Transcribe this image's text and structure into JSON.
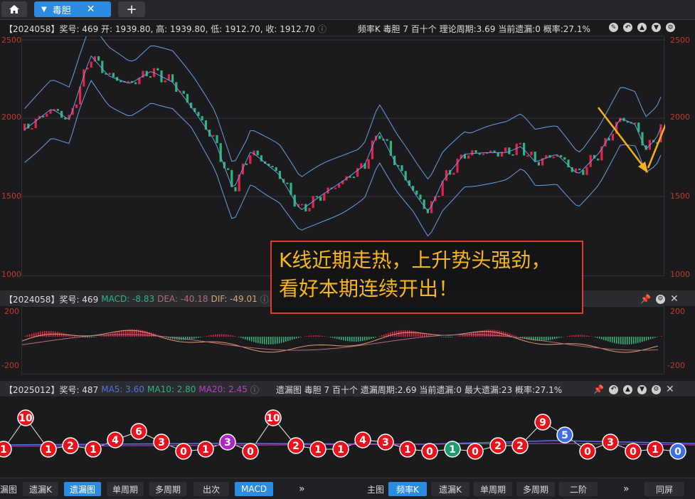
{
  "tabs": {
    "home_icon": "home-icon",
    "active_label": "毒胆",
    "add_label": "+"
  },
  "kline": {
    "header_left": "【2024058】奖号: 469  开: 1939.80, 高: 1939.80, 低: 1912.70, 收: 1912.70",
    "header_right": "频率K   毒胆   7   百十个   理论周期:3.69   当前遗漏:0   概率:27.1%",
    "y_ticks": [
      "2500",
      "2000",
      "1500",
      "1000"
    ]
  },
  "macd": {
    "header_prefix": "【2024058】奖号: 469",
    "macd_label": "MACD: -8.83",
    "dea_label": "DEA: -40.18",
    "dif_label": "DIF: -49.01",
    "y_ticks": [
      "200",
      "-200"
    ]
  },
  "miss": {
    "header_prefix": "【2025012】奖号: 487",
    "ma5": "MA5: 3.60",
    "ma10": "MA10: 2.80",
    "ma20": "MA20: 2.45",
    "header_right": "遗漏图   毒胆   7   百十个   遗漏周期:2.69   当前遗漏:0   最大遗漏:23   概率:27.1%",
    "nodes": [
      "1",
      "10",
      "1",
      "2",
      "1",
      "4",
      "6",
      "3",
      "0",
      "1",
      "3",
      "0",
      "10",
      "2",
      "1",
      "1",
      "4",
      "3",
      "1",
      "0",
      "1",
      "0",
      "2",
      "2",
      "9",
      "5",
      "0",
      "3",
      "0",
      "1",
      "0"
    ],
    "node_colors": {
      "default": "#e8121c",
      "purple": "#b125c4",
      "green": "#1d9b6c",
      "blue": "#3d6ee8"
    }
  },
  "annotation": {
    "line1": "K线近期走热，上升势头强劲，",
    "line2": "看好本期连续开出！"
  },
  "bottom": {
    "left_cut": "漏图",
    "left_buttons": [
      "遗漏K",
      "遗漏图",
      "单周期",
      "多周期",
      "出次",
      "MACD"
    ],
    "more1": "»",
    "main_label": "主图",
    "right_buttons": [
      "频率K",
      "遗漏K",
      "单周期",
      "多周期",
      "二阶"
    ],
    "more2": "»",
    "same_screen": "同屏"
  },
  "colors": {
    "up": "#e8224a",
    "down": "#2cb57e",
    "band": "#6a9fe0",
    "accent": "#2a8be0",
    "arrow": "#f2b21a"
  }
}
